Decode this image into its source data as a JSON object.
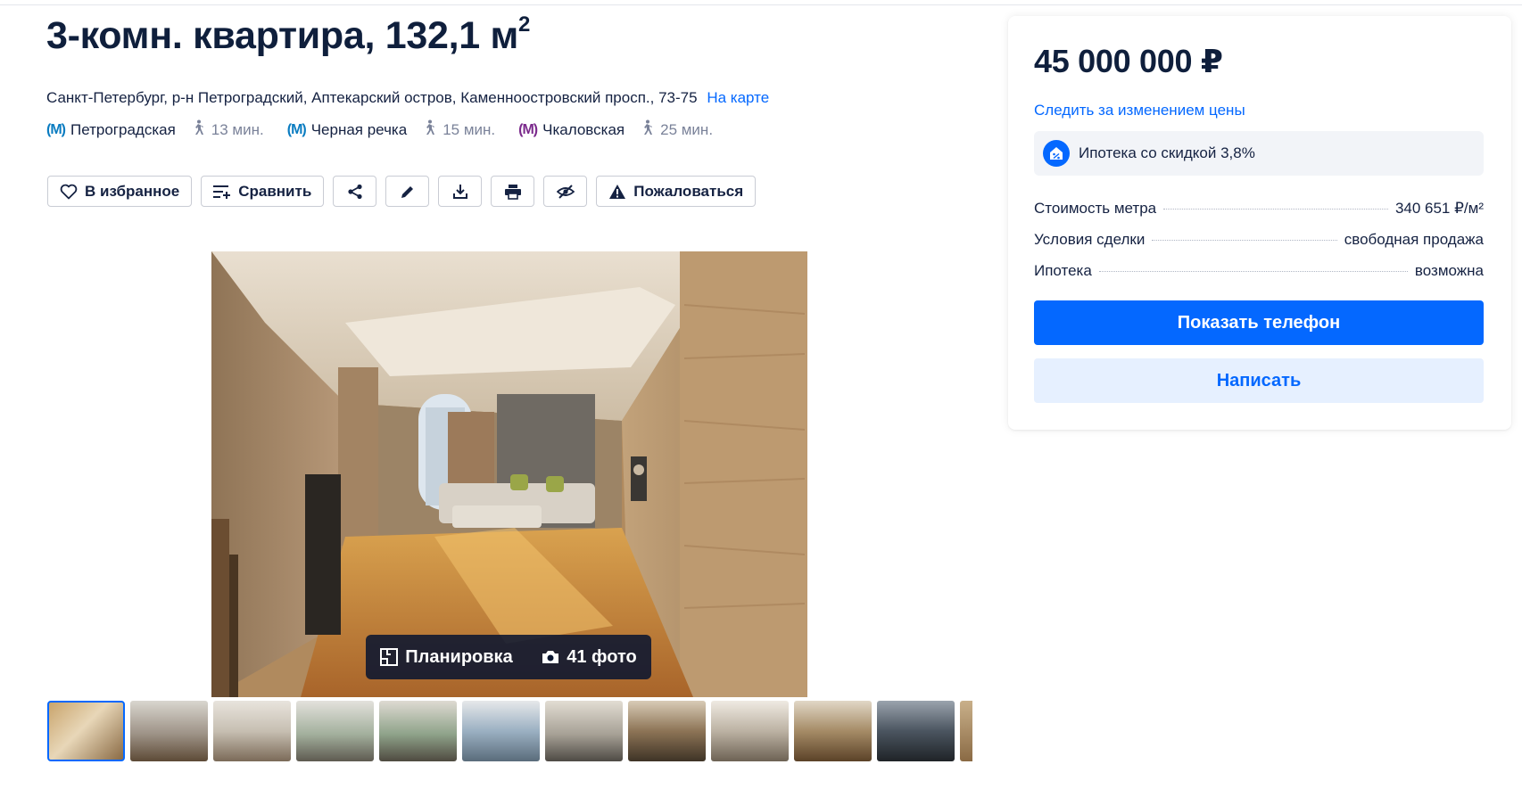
{
  "listing": {
    "title": "3-комн. квартира, 132,1 м",
    "title_sup": "2",
    "address": "Санкт-Петербург, р-н Петроградский, Аптекарский остров, Каменноостровский просп., 73-75",
    "map_link": "На карте",
    "metro": [
      {
        "name": "Петроградская",
        "time": "13 мин.",
        "color": "#0a7cc1"
      },
      {
        "name": "Черная речка",
        "time": "15 мин.",
        "color": "#0a7cc1"
      },
      {
        "name": "Чкаловская",
        "time": "25 мин.",
        "color": "#7b2a8c"
      }
    ]
  },
  "toolbar": {
    "favorite_label": "В избранное",
    "compare_label": "Сравнить",
    "complain_label": "Пожаловаться",
    "icons": [
      "heart-icon",
      "compare-icon",
      "share-icon",
      "edit-icon",
      "download-icon",
      "print-icon",
      "hide-icon",
      "warning-icon"
    ]
  },
  "gallery": {
    "plan_label": "Планировка",
    "photos_label": "41 фото",
    "thumbnail_count": 12,
    "active_thumbnail": 1
  },
  "card": {
    "price": "45 000 000 ₽",
    "track_price": "Следить за изменением цены",
    "mortgage_badge": "Ипотека со скидкой 3,8%",
    "rows": [
      {
        "label": "Стоимость метра",
        "value": "340 651 ₽/м²"
      },
      {
        "label": "Условия сделки",
        "value": "свободная продажа"
      },
      {
        "label": "Ипотека",
        "value": "возможна"
      }
    ],
    "show_phone": "Показать телефон",
    "write": "Написать"
  },
  "colors": {
    "accent": "#0468ff",
    "accent_light": "#e6f0ff",
    "text": "#152242",
    "muted": "#7a8299"
  }
}
